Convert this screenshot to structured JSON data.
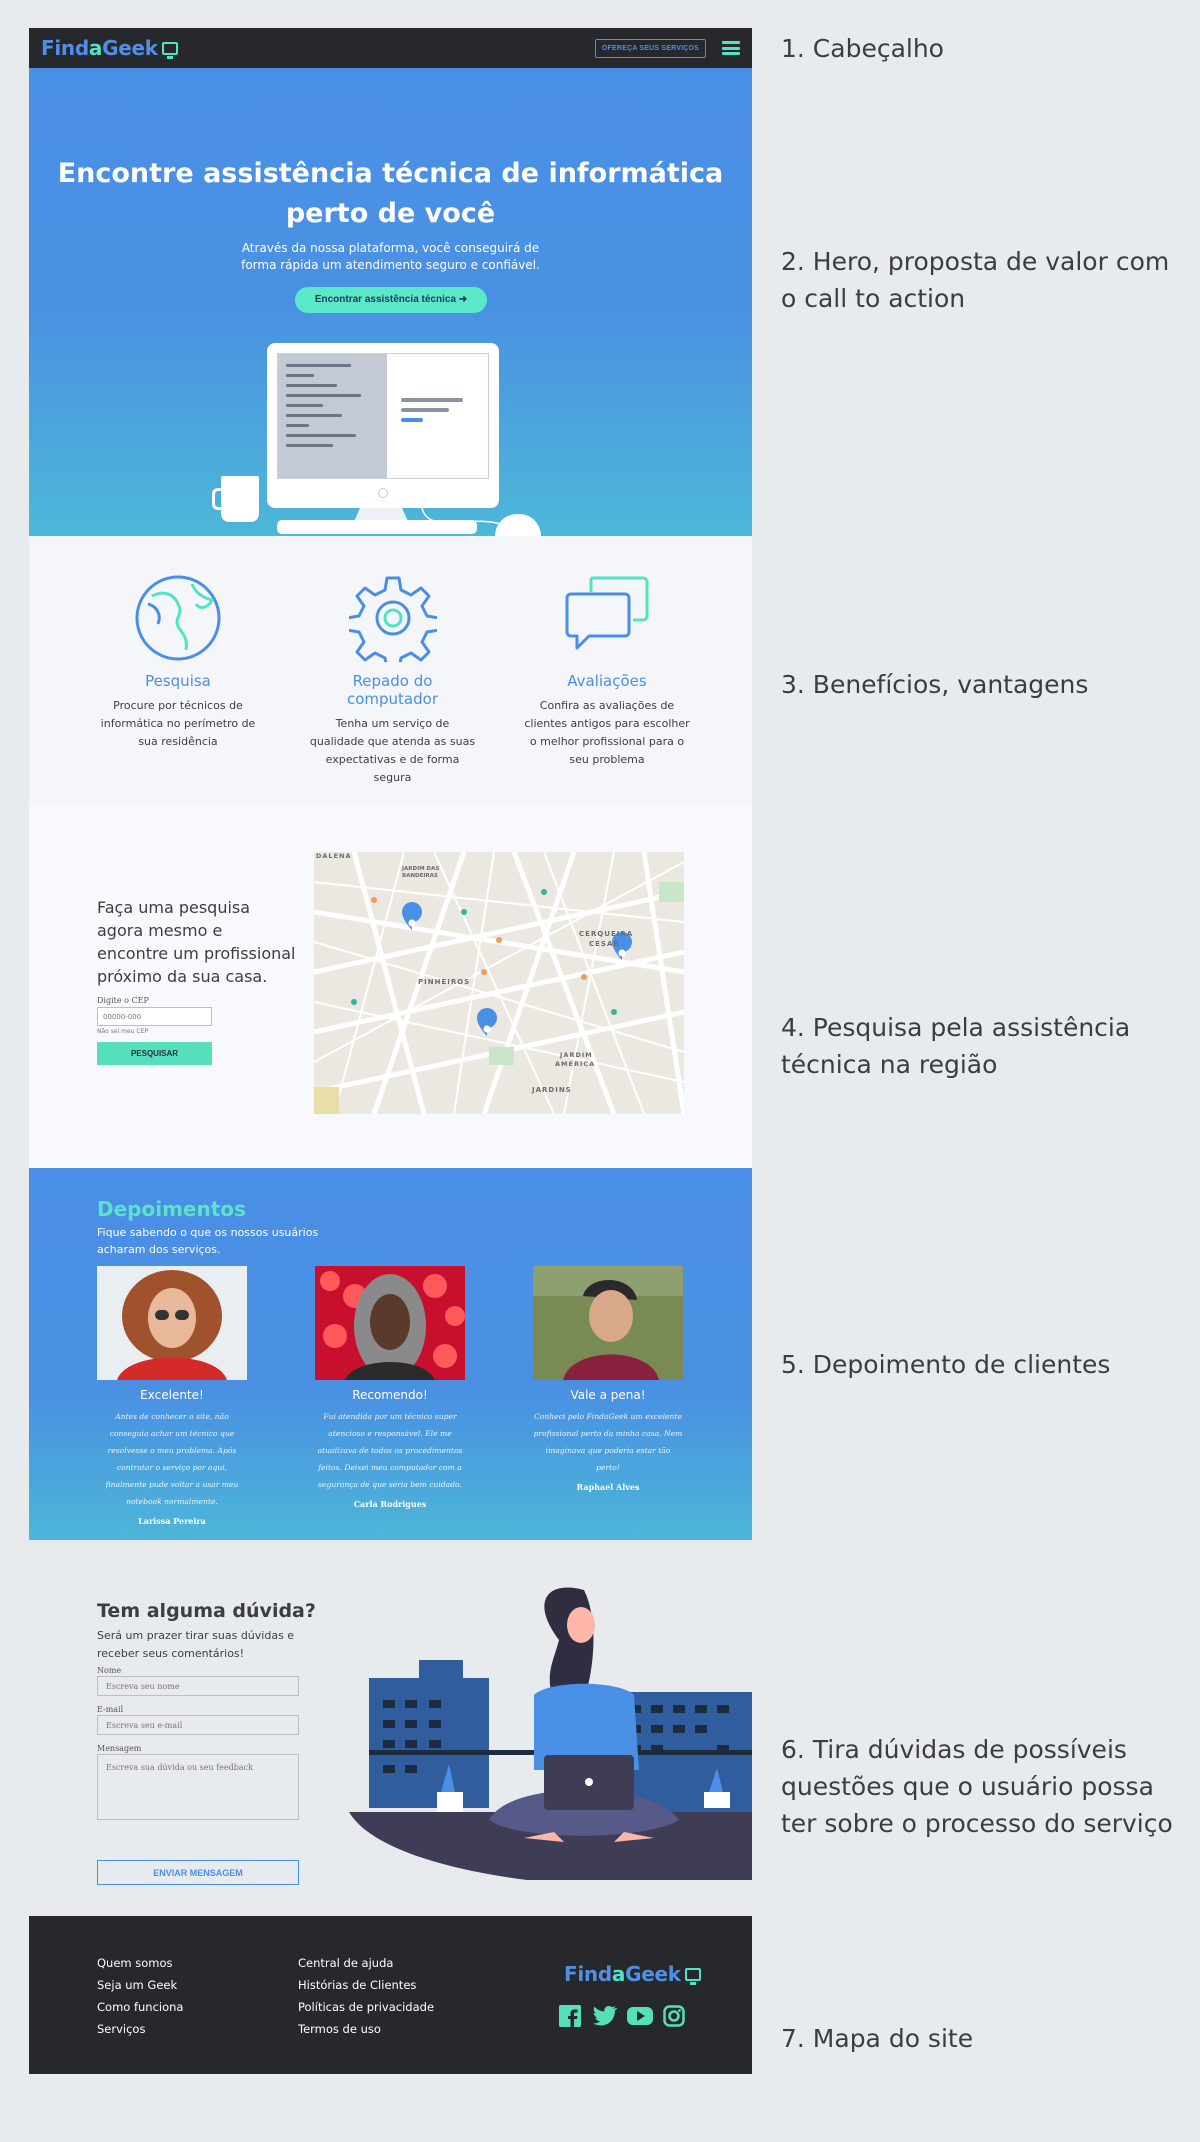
{
  "header": {
    "logo_find": "Find",
    "logo_a": "a",
    "logo_geek": "Geek",
    "offer_button": "OFEREÇA SEUS SERVIÇOS"
  },
  "hero": {
    "title": "Encontre assistência técnica de informática perto de você",
    "subtitle": "Através da nossa plataforma, você conseguirá de forma rápida um atendimento seguro e confiável.",
    "cta": "Encontrar assistência técnica ➜"
  },
  "benefits": [
    {
      "title": "Pesquisa",
      "text": "Procure por técnicos de informática no perímetro de sua residência"
    },
    {
      "title": "Repado do computador",
      "text": "Tenha um serviço de qualidade que atenda as suas expectativas e de forma segura"
    },
    {
      "title": "Avaliações",
      "text": "Confira as avaliações de clientes antigos para escolher o melhor profissional para o seu problema"
    }
  ],
  "search": {
    "title": "Faça uma pesquisa agora mesmo e encontre um profissional próximo da sua casa.",
    "cep_label": "Digite o CEP",
    "cep_placeholder": "00000-000",
    "cep_help": "Não sei meu CEP",
    "button": "PESQUISAR",
    "map_labels": {
      "pinheiros": "PINHEIROS",
      "cerqueira": "CERQUEIRA",
      "cesar": "CÉSAR",
      "jardim_america": "JARDIM",
      "america": "AMERICA",
      "jardins": "JARDINS",
      "dalena": "DALENA",
      "jardim_bandeiras": "JARDIM DAS",
      "bandeiras": "BANDEIRAS"
    }
  },
  "testimonials": {
    "title": "Depoimentos",
    "subtitle": "Fique sabendo o que os nossos usuários acharam dos serviços.",
    "items": [
      {
        "title": "Excelente!",
        "quote": "Antes de conhecer o site, não conseguia achar um técnico que resolvesse o meu problema. Após contratar o serviço por aqui, finalmente pude voltar a usar meu notebook normalmente.",
        "name": "Larissa Pereira"
      },
      {
        "title": "Recomendo!",
        "quote": "Fui atendida por um técnico super atencioso e responsável. Ele me atualizava de todos os procedimentos feitos. Deixei meu computador com a segurança de que seria bem cuidado.",
        "name": "Carla Rodrigues"
      },
      {
        "title": "Vale a pena!",
        "quote": "Conheci pelo FindaGeek um excelente profissional perto da minha casa. Nem imaginava que poderia estar tão perto!",
        "name": "Raphael Alves"
      }
    ]
  },
  "contact": {
    "title": "Tem alguma dúvida?",
    "subtitle": "Será um prazer tirar suas dúvidas e receber seus comentários!",
    "name_label": "Nome",
    "name_placeholder": "Escreva seu nome",
    "email_label": "E-mail",
    "email_placeholder": "Escreva seu e-mail",
    "message_label": "Mensagem",
    "message_placeholder": "Escreva sua dúvida ou seu feedback",
    "button": "ENVIAR MENSAGEM"
  },
  "footer": {
    "col1": [
      "Quem somos",
      "Seja um Geek",
      "Como funciona",
      "Serviços"
    ],
    "col2": [
      "Central de ajuda",
      "Histórias de Clientes",
      "Políticas de privacidade",
      "Termos de uso"
    ],
    "social": [
      "facebook-icon",
      "twitter-icon",
      "youtube-icon",
      "instagram-icon"
    ]
  },
  "annotations": [
    "1. Cabeçalho",
    "2. Hero, proposta de valor com o call to action",
    "3.  Benefícios, vantagens",
    "4. Pesquisa pela assistência técnica na região",
    "5.  Depoimento de clientes",
    "6. Tira dúvidas de possíveis questões que o usuário possa ter sobre o processo do serviço",
    "7. Mapa do site"
  ],
  "colors": {
    "blue": "#4a8fe6",
    "teal": "#55dfba",
    "dark": "#27282c"
  }
}
